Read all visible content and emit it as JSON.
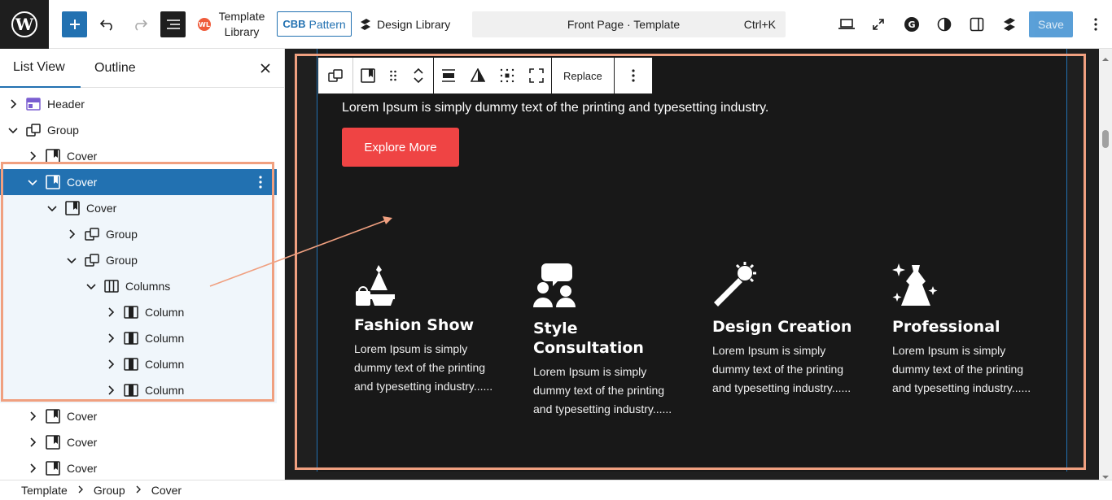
{
  "topbar": {
    "template_library_label": "Template Library",
    "pattern_brand": "CBB",
    "pattern_label": "Pattern",
    "design_library_label": "Design Library",
    "document_title": "Front Page · Template",
    "shortcut": "Ctrl+K",
    "save_label": "Save"
  },
  "sidebar": {
    "tab_listview": "List View",
    "tab_outline": "Outline",
    "tree": [
      {
        "label": "Header",
        "depth": 0,
        "expanded": false,
        "icon": "template-part-icon"
      },
      {
        "label": "Group",
        "depth": 0,
        "expanded": true,
        "icon": "group-icon"
      },
      {
        "label": "Cover",
        "depth": 1,
        "expanded": false,
        "icon": "cover-icon"
      },
      {
        "label": "Cover",
        "depth": 1,
        "expanded": true,
        "icon": "cover-icon",
        "selected": true
      },
      {
        "label": "Cover",
        "depth": 2,
        "expanded": true,
        "icon": "cover-icon"
      },
      {
        "label": "Group",
        "depth": 3,
        "expanded": false,
        "icon": "group-icon"
      },
      {
        "label": "Group",
        "depth": 3,
        "expanded": true,
        "icon": "group-icon"
      },
      {
        "label": "Columns",
        "depth": 4,
        "expanded": true,
        "icon": "columns-icon"
      },
      {
        "label": "Column",
        "depth": 5,
        "expanded": false,
        "icon": "column-icon"
      },
      {
        "label": "Column",
        "depth": 5,
        "expanded": false,
        "icon": "column-icon"
      },
      {
        "label": "Column",
        "depth": 5,
        "expanded": false,
        "icon": "column-icon"
      },
      {
        "label": "Column",
        "depth": 5,
        "expanded": false,
        "icon": "column-icon"
      },
      {
        "label": "Cover",
        "depth": 1,
        "expanded": false,
        "icon": "cover-icon"
      },
      {
        "label": "Cover",
        "depth": 1,
        "expanded": false,
        "icon": "cover-icon"
      },
      {
        "label": "Cover",
        "depth": 1,
        "expanded": false,
        "icon": "cover-icon"
      }
    ]
  },
  "breadcrumb": [
    "Template",
    "Group",
    "Cover"
  ],
  "block_toolbar": {
    "replace_label": "Replace"
  },
  "canvas": {
    "hero_text": "Lorem Ipsum is simply dummy text of the printing and typesetting industry.",
    "cta_label": "Explore More",
    "features": [
      {
        "title": "Fashion Show",
        "desc": "Lorem Ipsum is simply dummy text of the printing and typesetting industry......",
        "icon": "dress-shopping-icon"
      },
      {
        "title": "Style Consultation",
        "desc": "Lorem Ipsum is simply dummy text of the printing and typesetting industry......",
        "icon": "consultation-icon"
      },
      {
        "title": "Design Creation",
        "desc": "Lorem Ipsum is simply dummy text of the printing and typesetting industry......",
        "icon": "magic-wand-icon"
      },
      {
        "title": "Professional",
        "desc": "Lorem Ipsum is simply dummy text of the printing and typesetting industry......",
        "icon": "sparkle-dress-icon"
      }
    ]
  },
  "colors": {
    "accent": "#2271b1",
    "annotation": "#f0a080",
    "cta": "#ef4444",
    "canvas_bg": "#181818"
  }
}
